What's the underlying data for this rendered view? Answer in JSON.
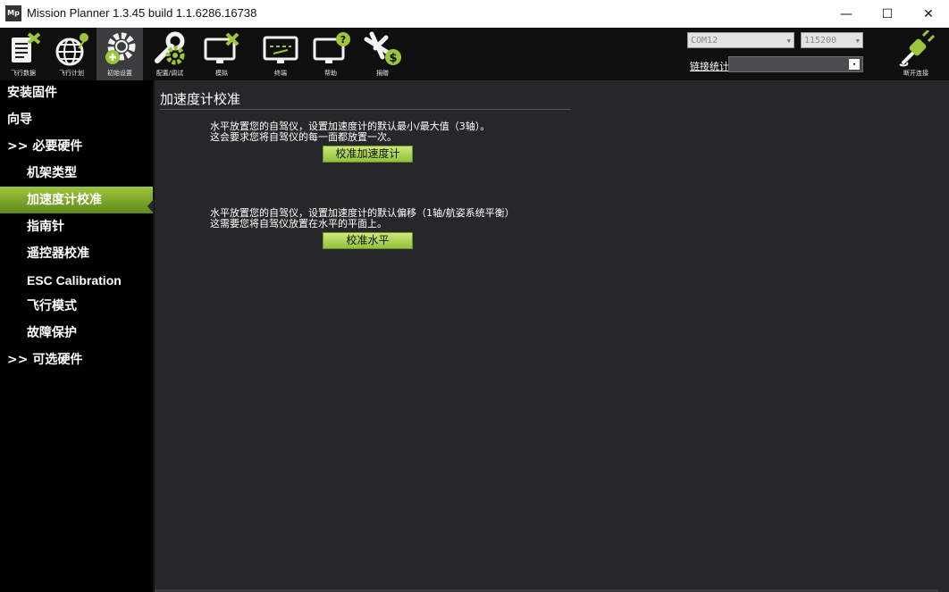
{
  "window": {
    "title": "Mission Planner 1.3.45 build 1.1.6286.16738",
    "logo": "Mp",
    "controls": {
      "minimize": "—",
      "maximize": "☐",
      "close": "✕"
    }
  },
  "toolbar": {
    "items": [
      {
        "label": "飞行数据",
        "icon": "flight-data-icon"
      },
      {
        "label": "飞行计划",
        "icon": "flight-plan-icon"
      },
      {
        "label": "初始设置",
        "icon": "initial-setup-icon"
      },
      {
        "label": "配置/调试",
        "icon": "config-tuning-icon"
      },
      {
        "label": "模拟",
        "icon": "simulation-icon"
      },
      {
        "label": "终端",
        "icon": "terminal-icon"
      },
      {
        "label": "帮助",
        "icon": "help-icon"
      },
      {
        "label": "捐赠",
        "icon": "donate-icon"
      }
    ],
    "port": "COM12",
    "baud": "115200",
    "link_stats": "链接统计",
    "connect_label": "断开连接",
    "accent": "#9bc63a"
  },
  "sidebar": {
    "items": [
      {
        "label": "安装固件"
      },
      {
        "label": "向导"
      },
      {
        "label": ">> 必要硬件"
      },
      {
        "label": "机架类型"
      },
      {
        "label": "加速度计校准"
      },
      {
        "label": "指南针"
      },
      {
        "label": "遥控器校准"
      },
      {
        "label": "ESC Calibration"
      },
      {
        "label": "飞行模式"
      },
      {
        "label": "故障保护"
      },
      {
        "label": ">> 可选硬件"
      }
    ]
  },
  "main": {
    "title": "加速度计校准",
    "section1": {
      "line1": "水平放置您的自驾仪，设置加速度计的默认最小/最大值（3轴）。",
      "line2": "这会要求您将自驾仪的每一面都放置一次。",
      "button": "校准加速度计"
    },
    "section2": {
      "line1": "水平放置您的自驾仪，设置加速度计的默认偏移（1轴/航姿系统平衡）",
      "line2": "这需要您将自驾仪放置在水平的平面上。",
      "button": "校准水平"
    }
  }
}
